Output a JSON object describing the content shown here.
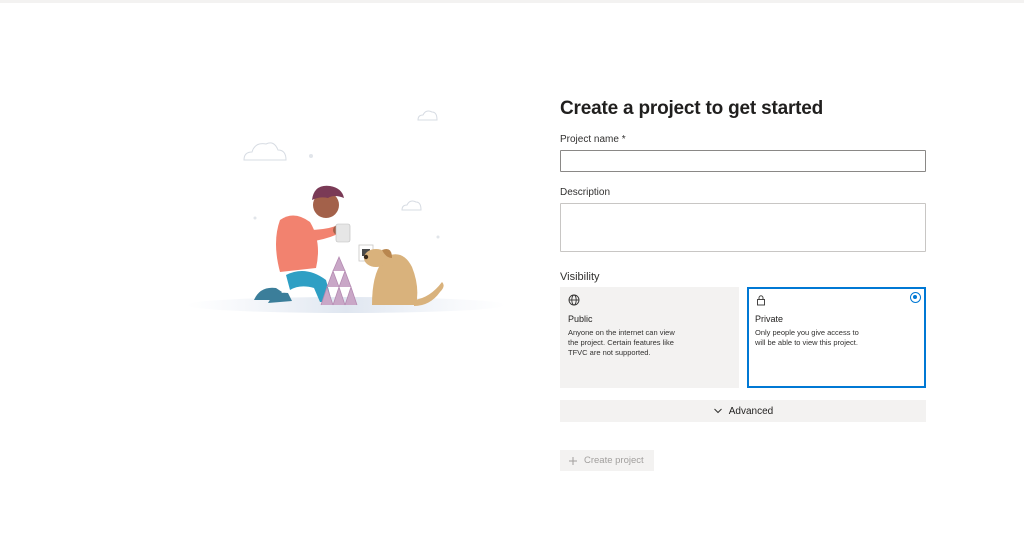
{
  "form": {
    "title": "Create a project to get started",
    "project_name_label": "Project name *",
    "project_name_value": "",
    "description_label": "Description",
    "description_value": "",
    "visibility_label": "Visibility",
    "visibility_options": [
      {
        "title": "Public",
        "description": "Anyone on the internet can view the project. Certain features like TFVC are not supported.",
        "icon": "globe-icon",
        "selected": false
      },
      {
        "title": "Private",
        "description": "Only people you give access to will be able to view this project.",
        "icon": "lock-icon",
        "selected": true
      }
    ],
    "advanced_label": "Advanced",
    "create_label": "Create project"
  },
  "colors": {
    "accent": "#0078d4",
    "card_bg": "#f3f2f1",
    "disabled_text": "#a19f9d"
  }
}
